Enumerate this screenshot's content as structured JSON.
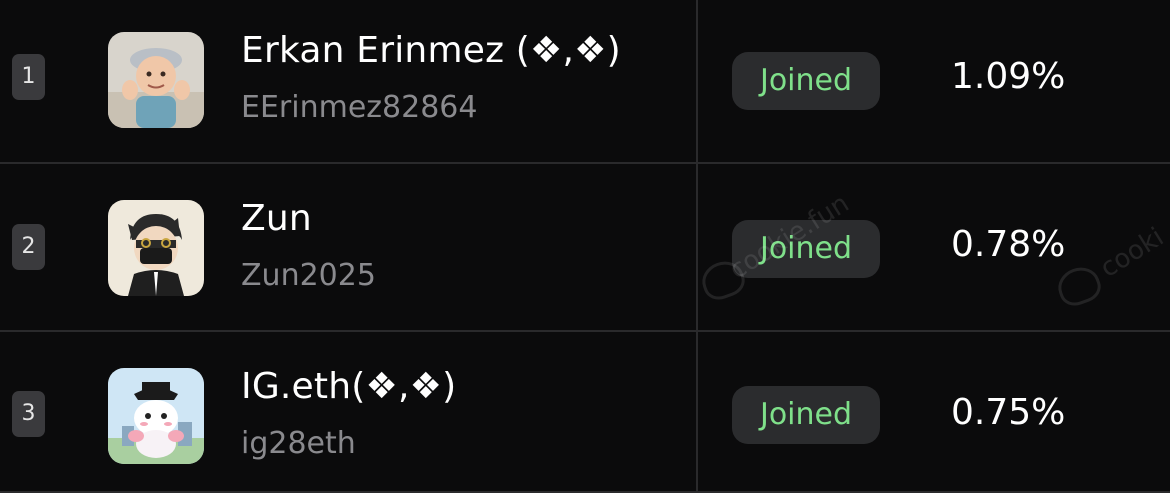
{
  "rows": [
    {
      "rank": "1",
      "name": "Erkan Erinmez (❖,❖)",
      "handle": "EErinmez82864",
      "status": "Joined",
      "share": "1.09%",
      "avatar": "toddler-photo"
    },
    {
      "rank": "2",
      "name": "Zun",
      "handle": "Zun2025",
      "status": "Joined",
      "share": "0.78%",
      "avatar": "masked-cartoon-boy"
    },
    {
      "rank": "3",
      "name": "IG.eth(❖,❖)",
      "handle": "ig28eth",
      "status": "Joined",
      "share": "0.75%",
      "avatar": "white-cat-character"
    }
  ],
  "watermark": {
    "text_1": "cookie.fun",
    "text_2": "cooki"
  },
  "colors": {
    "background": "#0b0b0c",
    "divider": "#2a2a2c",
    "badge_bg": "#2b2c2e",
    "joined_text": "#7fe08a",
    "handle_text": "#8a8a8e",
    "rank_bg": "#3a3a3d"
  }
}
